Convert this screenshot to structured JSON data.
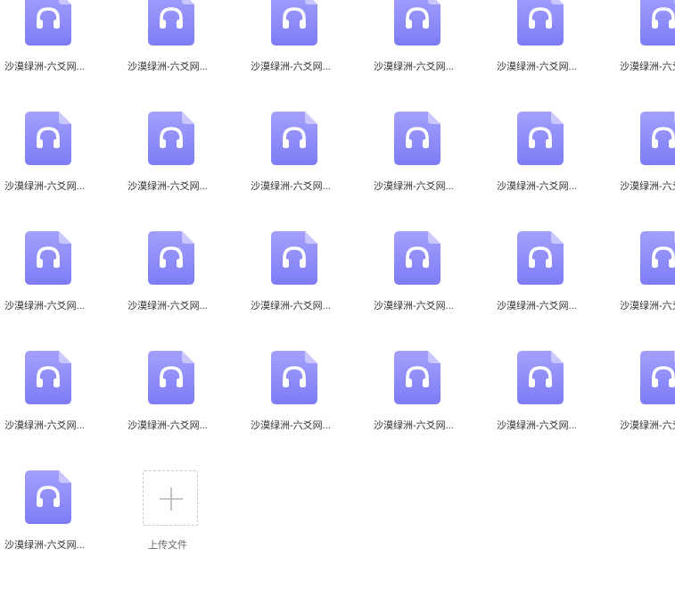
{
  "files": [
    {
      "name": "沙漠绿洲-六爻网...",
      "icon": "audio-file-icon"
    },
    {
      "name": "沙漠绿洲-六爻网...",
      "icon": "audio-file-icon"
    },
    {
      "name": "沙漠绿洲-六爻网...",
      "icon": "audio-file-icon"
    },
    {
      "name": "沙漠绿洲-六爻网...",
      "icon": "audio-file-icon"
    },
    {
      "name": "沙漠绿洲-六爻网...",
      "icon": "audio-file-icon"
    },
    {
      "name": "沙漠绿洲-六爻网...",
      "icon": "audio-file-icon"
    },
    {
      "name": "沙漠绿洲-六爻网...",
      "icon": "audio-file-icon"
    },
    {
      "name": "沙漠绿洲-六爻网...",
      "icon": "audio-file-icon"
    },
    {
      "name": "沙漠绿洲-六爻网...",
      "icon": "audio-file-icon"
    },
    {
      "name": "沙漠绿洲-六爻网...",
      "icon": "audio-file-icon"
    },
    {
      "name": "沙漠绿洲-六爻网...",
      "icon": "audio-file-icon"
    },
    {
      "name": "沙漠绿洲-六爻网...",
      "icon": "audio-file-icon"
    },
    {
      "name": "沙漠绿洲-六爻网...",
      "icon": "audio-file-icon"
    },
    {
      "name": "沙漠绿洲-六爻网...",
      "icon": "audio-file-icon"
    },
    {
      "name": "沙漠绿洲-六爻网...",
      "icon": "audio-file-icon"
    },
    {
      "name": "沙漠绿洲-六爻网...",
      "icon": "audio-file-icon"
    },
    {
      "name": "沙漠绿洲-六爻网...",
      "icon": "audio-file-icon"
    },
    {
      "name": "沙漠绿洲-六爻网...",
      "icon": "audio-file-icon"
    },
    {
      "name": "沙漠绿洲-六爻网...",
      "icon": "audio-file-icon"
    },
    {
      "name": "沙漠绿洲-六爻网...",
      "icon": "audio-file-icon"
    },
    {
      "name": "沙漠绿洲-六爻网...",
      "icon": "audio-file-icon"
    },
    {
      "name": "沙漠绿洲-六爻网...",
      "icon": "audio-file-icon"
    },
    {
      "name": "沙漠绿洲-六爻网...",
      "icon": "audio-file-icon"
    },
    {
      "name": "沙漠绿洲-六爻网...",
      "icon": "audio-file-icon"
    },
    {
      "name": "沙漠绿洲-六爻网...",
      "icon": "audio-file-icon"
    }
  ],
  "upload": {
    "label": "上传文件",
    "icon": "plus-icon"
  },
  "colors": {
    "icon_gradient_top": "#a3a0fb",
    "icon_gradient_bottom": "#7e7cf6",
    "icon_fold": "#c9c7fd",
    "file_name_text": "#333333",
    "upload_border": "#c8c8c8"
  }
}
